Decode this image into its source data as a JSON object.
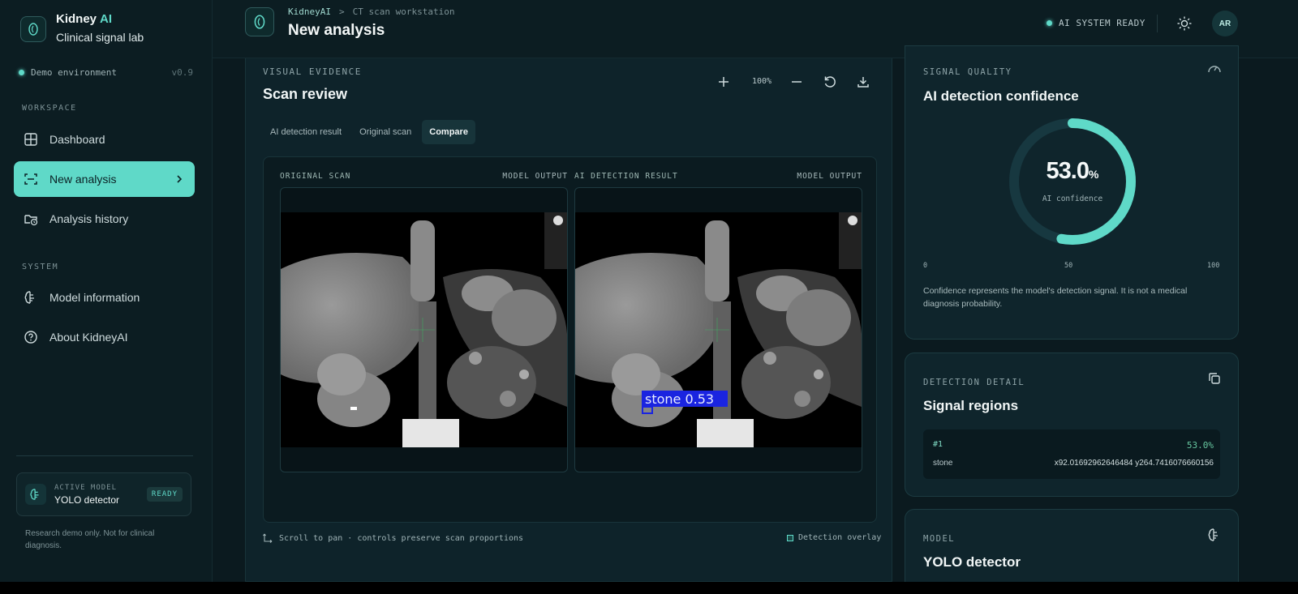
{
  "brand": {
    "name": "Kidney",
    "name_accent": "AI",
    "subtitle": "Clinical signal lab"
  },
  "environment": {
    "label": "Demo environment",
    "version": "v0.9"
  },
  "sidebar": {
    "workspace_label": "WORKSPACE",
    "system_label": "SYSTEM",
    "items": [
      {
        "label": "Dashboard",
        "icon": "grid-icon"
      },
      {
        "label": "New analysis",
        "icon": "scan-icon",
        "active": true
      },
      {
        "label": "Analysis history",
        "icon": "folder-clock-icon"
      },
      {
        "label": "Model information",
        "icon": "brain-icon"
      },
      {
        "label": "About KidneyAI",
        "icon": "help-circle-icon"
      }
    ],
    "active_model": {
      "label": "ACTIVE MODEL",
      "name": "YOLO detector",
      "status": "READY"
    },
    "disclaimer": "Research demo only. Not for clinical diagnosis."
  },
  "header": {
    "breadcrumb": [
      "KidneyAI",
      ">",
      "CT scan workstation"
    ],
    "title": "New analysis",
    "status": "AI SYSTEM READY",
    "avatar": "AR"
  },
  "scan_review": {
    "section_label": "VISUAL EVIDENCE",
    "title": "Scan review",
    "zoom": "100%",
    "tabs": [
      "AI detection result",
      "Original scan",
      "Compare"
    ],
    "active_tab": 2,
    "left_pane": {
      "title": "ORIGINAL SCAN",
      "tag": "MODEL OUTPUT"
    },
    "right_pane": {
      "title": "AI DETECTION RESULT",
      "tag": "MODEL OUTPUT"
    },
    "detection_label": "stone 0.53",
    "footer_hint": "Scroll to pan · controls preserve scan proportions",
    "overlay_label": "Detection overlay"
  },
  "signal_quality": {
    "section_label": "SIGNAL QUALITY",
    "title": "AI detection confidence",
    "confidence_value": "53.0",
    "confidence_unit": "%",
    "confidence_fraction": 0.53,
    "confidence_sub": "AI confidence",
    "scale": [
      "0",
      "50",
      "100"
    ],
    "note": "Confidence represents the model's detection signal. It is not a medical diagnosis probability."
  },
  "detection_detail": {
    "section_label": "DETECTION DETAIL",
    "title": "Signal regions",
    "regions": [
      {
        "id": "#1",
        "confidence": "53.0%",
        "label": "stone",
        "coords": "x92.01692962646484 y264.7416076660156"
      }
    ]
  },
  "model_card": {
    "section_label": "MODEL",
    "title": "YOLO detector"
  },
  "colors": {
    "accent": "#5fd9c8",
    "background": "#0b1a1f",
    "panel": "#0f252c",
    "detection_box": "#1a24e0"
  }
}
